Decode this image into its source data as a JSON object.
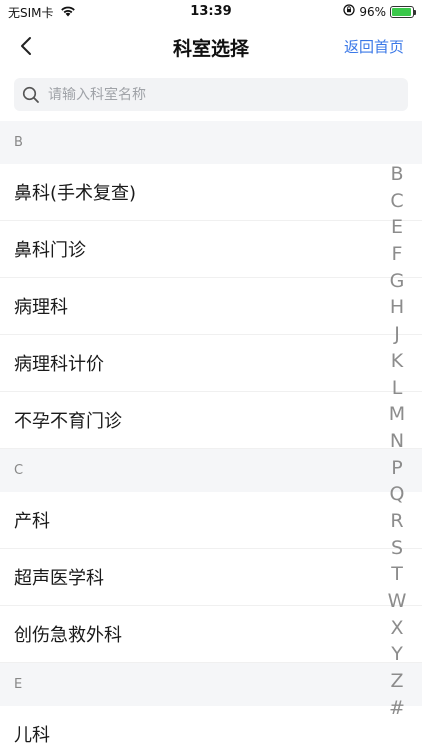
{
  "status": {
    "carrier": "无SIM卡",
    "time": "13:39",
    "battery": "96%",
    "battery_level": 0.96
  },
  "nav": {
    "title": "科室选择",
    "home_label": "返回首页"
  },
  "search": {
    "placeholder": "请输入科室名称"
  },
  "sections": [
    {
      "letter": "B",
      "items": [
        "鼻科(手术复查)",
        "鼻科门诊",
        "病理科",
        "病理科计价",
        "不孕不育门诊"
      ]
    },
    {
      "letter": "C",
      "items": [
        "产科",
        "超声医学科",
        "创伤急救外科"
      ]
    },
    {
      "letter": "E",
      "items": [
        "儿科"
      ]
    }
  ],
  "index_letters": [
    "B",
    "C",
    "E",
    "F",
    "G",
    "H",
    "J",
    "K",
    "L",
    "M",
    "N",
    "P",
    "Q",
    "R",
    "S",
    "T",
    "W",
    "X",
    "Y",
    "Z",
    "#"
  ],
  "colors": {
    "accent": "#3b78e7",
    "battery": "#3ac84a"
  }
}
